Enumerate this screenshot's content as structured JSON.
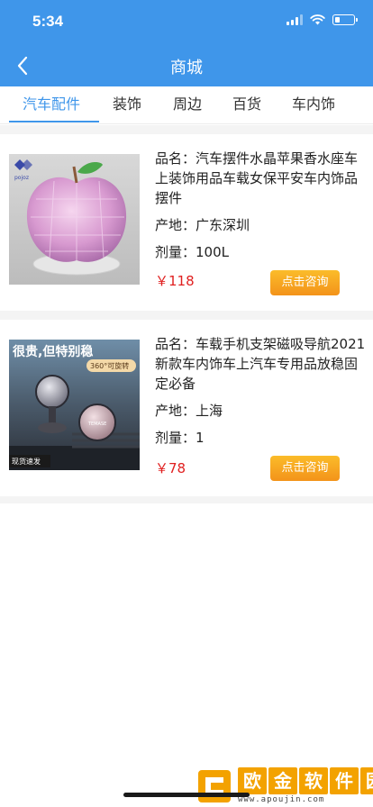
{
  "status_bar": {
    "time": "5:34",
    "battery_level": 0.3
  },
  "nav": {
    "title": "商城"
  },
  "tabs": [
    {
      "label": "汽车配件",
      "active": true
    },
    {
      "label": "装饰",
      "active": false
    },
    {
      "label": "周边",
      "active": false
    },
    {
      "label": "百货",
      "active": false
    },
    {
      "label": "车内饰",
      "active": false
    }
  ],
  "products": [
    {
      "name": "品名：汽车摆件水晶苹果香水座车上装饰用品车载女保平安车内饰品摆件",
      "origin": "产地：广东深圳",
      "dosage": "剂量：100L",
      "price": "￥118",
      "button": "点击咨询",
      "image_brand": "pojoz"
    },
    {
      "name": "品名：车载手机支架磁吸导航2021新款车内饰车上汽车专用品放稳固定必备",
      "origin": "产地：上海",
      "dosage": "剂量：1",
      "price": "￥78",
      "button": "点击咨询",
      "image_headline": "很贵,但特别稳",
      "image_badge": "360°可旋转",
      "image_tag": "现货速发",
      "image_brand": "TEMASE"
    }
  ],
  "watermark": {
    "title_chars": [
      "欧",
      "金",
      "软",
      "件",
      "园"
    ],
    "url": "www.apoujin.com"
  },
  "colors": {
    "primary": "#3f96ea",
    "price": "#e02020",
    "button": "#f3931a"
  }
}
